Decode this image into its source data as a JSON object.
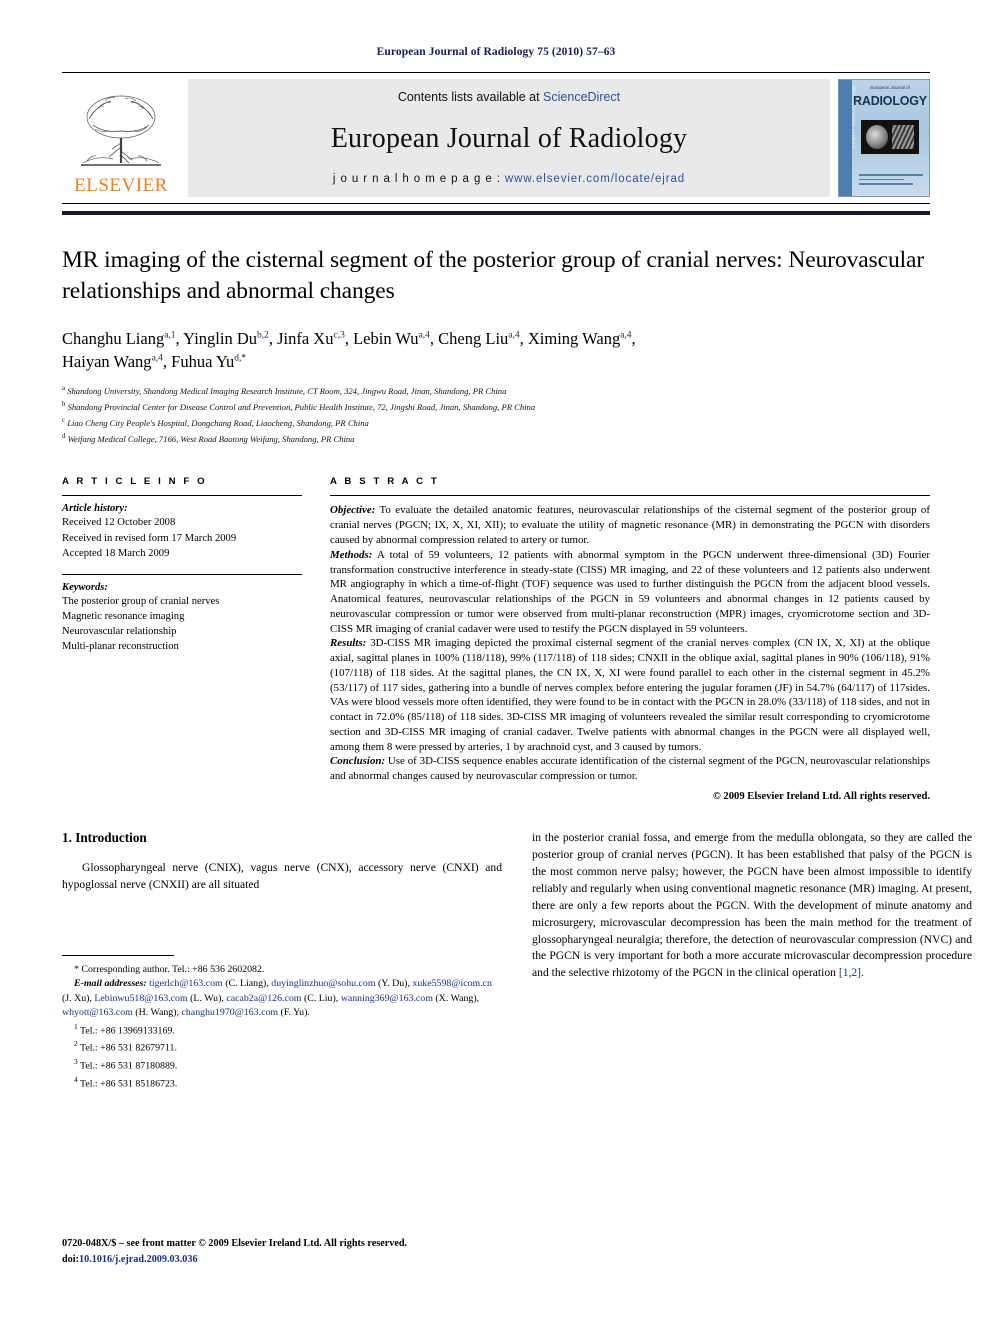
{
  "running_head": "European Journal of Radiology 75 (2010) 57–63",
  "masthead": {
    "publisher": "ELSEVIER",
    "contents_prefix": "Contents lists available at ",
    "contents_link": "ScienceDirect",
    "journal_name": "European Journal of Radiology",
    "homepage_prefix": "j o u r n a l   h o m e p a g e :  ",
    "homepage_url": "www.elsevier.com/locate/ejrad",
    "cover": {
      "top_line": "European Journal of",
      "title": "RADIOLOGY",
      "spine_text": "European Journal of Radiology"
    }
  },
  "article": {
    "title": "MR imaging of the cisternal segment of the posterior group of cranial nerves: Neurovascular relationships and abnormal changes",
    "authors_line1": "Changhu Liang a,1, Yinglin Du b,2, Jinfa Xu c,3, Lebin Wu a,4, Cheng Liu a,4, Ximing Wang a,4,",
    "authors_line2": "Haiyan Wang a,4, Fuhua Yu d,*",
    "affiliations": [
      {
        "marker": "a",
        "text": "Shandong University, Shandong Medical Imaging Research Institute, CT Room, 324, Jingwu Road, Jinan, Shandong, PR China"
      },
      {
        "marker": "b",
        "text": "Shandong Provincial Center for Disease Control and Prevention, Public Health Institute, 72, Jingshi Road, Jinan, Shandong, PR China"
      },
      {
        "marker": "c",
        "text": "Liao Cheng City People's Hospital, Dongchang Road, Liaocheng, Shandong, PR China"
      },
      {
        "marker": "d",
        "text": "Weifang Medical College, 7166, West Road Baotong Weifang, Shandong, PR China"
      }
    ]
  },
  "article_info": {
    "heading": "A R T I C L E   I N F O",
    "history_label": "Article history:",
    "history": [
      "Received 12 October 2008",
      "Received in revised form 17 March 2009",
      "Accepted 18 March 2009"
    ],
    "keywords_label": "Keywords:",
    "keywords": [
      "The posterior group of cranial nerves",
      "Magnetic resonance imaging",
      "Neurovascular relationship",
      "Multi-planar reconstruction"
    ]
  },
  "abstract": {
    "heading": "A B S T R A C T",
    "sections": [
      {
        "lead": "Objective:",
        "text": " To evaluate the detailed anatomic features, neurovascular relationships of the cisternal segment of the posterior group of cranial nerves (PGCN; IX, X, XI, XII); to evaluate the utility of magnetic resonance (MR) in demonstrating the PGCN with disorders caused by abnormal compression related to artery or tumor."
      },
      {
        "lead": "Methods:",
        "text": " A total of 59 volunteers, 12 patients with abnormal symptom in the PGCN underwent three-dimensional (3D) Fourier transformation constructive interference in steady-state (CISS) MR imaging, and 22 of these volunteers and 12 patients also underwent MR angiography in which a time-of-flight (TOF) sequence was used to further distinguish the PGCN from the adjacent blood vessels. Anatomical features, neurovascular relationships of the PGCN in 59 volunteers and abnormal changes in 12 patients caused by neurovascular compression or tumor were observed from multi-planar reconstruction (MPR) images, cryomicrotome section and 3D-CISS MR imaging of cranial cadaver were used to testify the PGCN displayed in 59 volunteers."
      },
      {
        "lead": "Results:",
        "text": " 3D-CISS MR imaging depicted the proximal cisternal segment of the cranial nerves complex (CN IX, X, XI) at the oblique axial, sagittal planes in 100% (118/118), 99% (117/118) of 118 sides; CNXII in the oblique axial, sagittal planes in 90% (106/118), 91% (107/118) of 118 sides. At the sagittal planes, the CN IX, X, XI were found parallel to each other in the cisternal segment in 45.2% (53/117) of 117 sides, gathering into a bundle of nerves complex before entering the jugular foramen (JF) in 54.7% (64/117) of 117sides. VAs were blood vessels more often identified, they were found to be in contact with the PGCN in 28.0% (33/118) of 118 sides, and not in contact in 72.0% (85/118) of 118 sides. 3D-CISS MR imaging of volunteers revealed the similar result corresponding to cryomicrotome section and 3D-CISS MR imaging of cranial cadaver. Twelve patients with abnormal changes in the PGCN were all displayed well, among them 8 were pressed by arteries, 1 by arachnoid cyst, and 3 caused by tumors."
      },
      {
        "lead": "Conclusion:",
        "text": " Use of 3D-CISS sequence enables accurate identification of the cisternal segment of the PGCN, neurovascular relationships and abnormal changes caused by neurovascular compression or tumor."
      }
    ],
    "copyright": "© 2009 Elsevier Ireland Ltd. All rights reserved."
  },
  "introduction": {
    "heading": "1.  Introduction",
    "left_text": "Glossopharyngeal nerve (CNIX), vagus nerve (CNX), accessory nerve (CNXI) and hypoglossal nerve (CNXII) are all situated",
    "right_text": "in the posterior cranial fossa, and emerge from the medulla oblongata, so they are called the posterior group of cranial nerves (PGCN). It has been established that palsy of the PGCN is the most common nerve palsy; however, the PGCN have been almost impossible to identify reliably and regularly when using conventional magnetic resonance (MR) imaging. At present, there are only a few reports about the PGCN. With the development of minute anatomy and microsurgery, microvascular decompression has been the main method for the treatment of glossopharyngeal neuralgia; therefore, the detection of neurovascular compression (NVC) and the PGCN is very important for both a more accurate microvascular decompression procedure and the selective rhizotomy of the PGCN in the clinical operation ",
    "right_citation": "[1,2]",
    "right_text_end": "."
  },
  "footnotes": {
    "corresponding": "* Corresponding author. Tel.: +86 536 2602082.",
    "email_label": "E-mail addresses:",
    "emails": [
      {
        "address": "tigerlch@163.com",
        "name": " (C. Liang), "
      },
      {
        "address": "duyinglinzhuo@sohu.com",
        "name": " (Y. Du), "
      },
      {
        "address": "xuke5598@icom.cn",
        "name": " (J. Xu), "
      },
      {
        "address": "Lebinwu518@163.com",
        "name": " (L. Wu), "
      },
      {
        "address": "cacab2a@126.com",
        "name": " (C. Liu), "
      },
      {
        "address": "wanning369@163.com",
        "name": " (X. Wang), "
      },
      {
        "address": "whyott@163.com",
        "name": " (H. Wang), "
      },
      {
        "address": "changhu1970@163.com",
        "name": " (F. Yu)."
      }
    ],
    "tels": [
      {
        "marker": "1",
        "text": "Tel.: +86 13969133169."
      },
      {
        "marker": "2",
        "text": "Tel.: +86 531 82679711."
      },
      {
        "marker": "3",
        "text": "Tel.: +86 531 87180889."
      },
      {
        "marker": "4",
        "text": "Tel.: +86 531 85186723."
      }
    ]
  },
  "footer": {
    "issn_line": "0720-048X/$ – see front matter © 2009 Elsevier Ireland Ltd. All rights reserved.",
    "doi_label": "doi:",
    "doi_value": "10.1016/j.ejrad.2009.03.036"
  },
  "colors": {
    "header_blue": "#1a1a5e",
    "link_blue": "#2b50a1",
    "elsevier_orange": "#F08020"
  }
}
